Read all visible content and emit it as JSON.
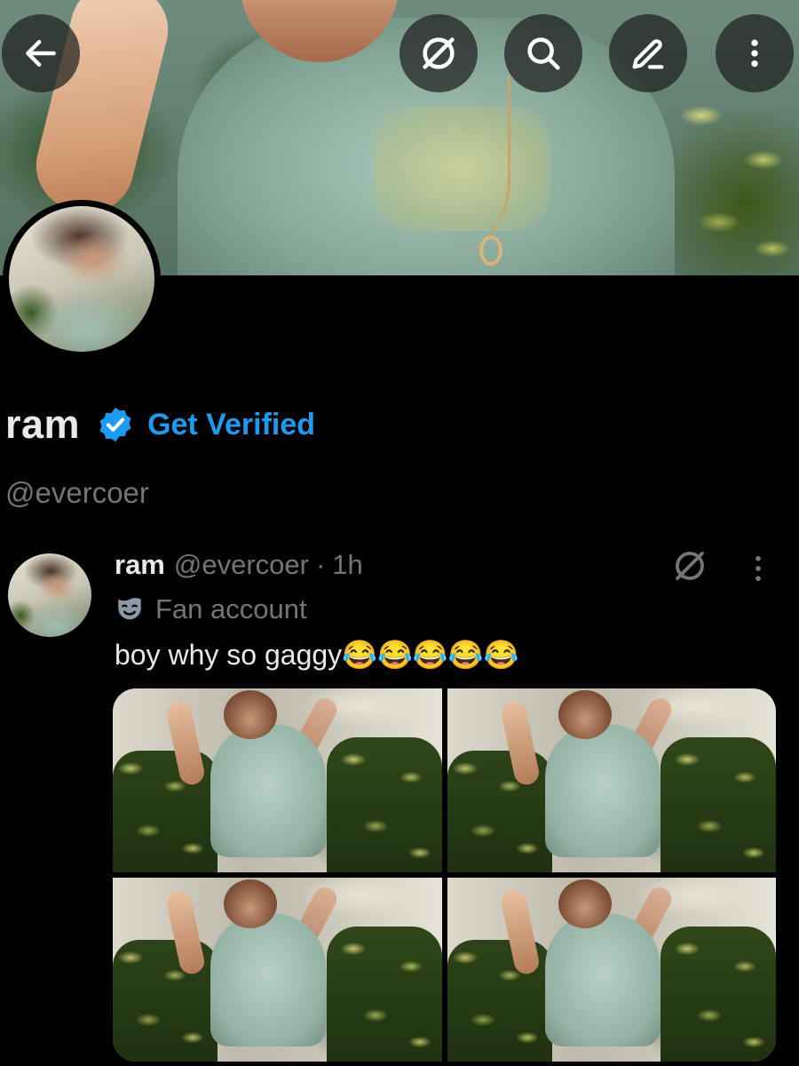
{
  "colors": {
    "background": "#000000",
    "primary_text": "#e7e9ea",
    "secondary_text": "#71767b",
    "accent_blue": "#1d9bf0"
  },
  "top_bar": {
    "back_icon": "arrow-left-icon",
    "grok_icon": "grok-icon",
    "search_icon": "search-icon",
    "edit_icon": "edit-pencil-icon",
    "more_icon": "more-vertical-icon"
  },
  "profile": {
    "name": "ram",
    "badge_icon": "verified-badge-icon",
    "get_verified_label": "Get Verified",
    "handle": "@evercoer"
  },
  "post": {
    "author_name": "ram",
    "author_handle": "@evercoer",
    "separator": "·",
    "time": "1h",
    "label_icon": "theater-mask-icon",
    "label_text": "Fan account",
    "text": "boy why so gaggy😂😂😂😂😂",
    "media_count": 4
  }
}
